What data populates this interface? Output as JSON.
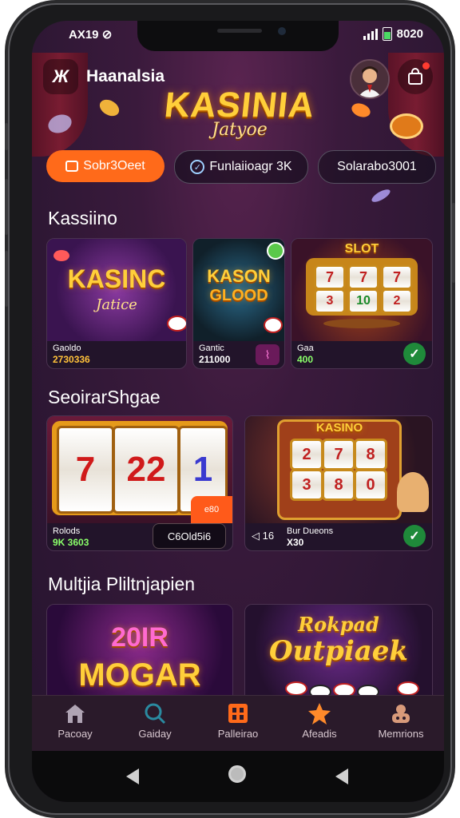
{
  "status_bar": {
    "time": "AX19 ⊘",
    "right_text": "8020"
  },
  "header": {
    "app_title": "Haanalsia",
    "menu_glyph": "Ж"
  },
  "logo": {
    "title": "KASINIA",
    "subtitle": "Jatyoe"
  },
  "filters": [
    {
      "label": "Sobr3Oeet",
      "icon": "bag-icon",
      "active": true
    },
    {
      "label": "Funlaiioagr 3K",
      "icon": "check-circle-icon",
      "active": false
    },
    {
      "label": "Solarabo3001",
      "icon": "",
      "active": false
    }
  ],
  "sections": {
    "s1": {
      "title": "Kassiino"
    },
    "s2": {
      "title": "SeoirarShgae"
    },
    "s3": {
      "title": "Multjia Pliltnjapien"
    }
  },
  "cards_row1": [
    {
      "art_title": "KASINC",
      "art_sub": "Jatice",
      "line1": "Gaoldo",
      "line2": "2730336"
    },
    {
      "art_title": "KASON",
      "art_sub": "GLOOD",
      "line1": "Gantic",
      "line2": "211000"
    },
    {
      "art_title": "SLOT",
      "reels": [
        "7",
        "7",
        "7",
        "3",
        "10",
        "2"
      ],
      "line1": "Gaa",
      "line2": "400"
    }
  ],
  "cards_row2": [
    {
      "reels": [
        "7",
        "22",
        "1"
      ],
      "corner": "e80",
      "line1": "Rolods",
      "line2": "9K 3603",
      "button": "C6Old5i6"
    },
    {
      "art_title": "KASINO",
      "reels": [
        "2",
        "7",
        "8",
        "3",
        "8",
        "0"
      ],
      "line1": "Bur Dueons",
      "line2": "X30",
      "prefix": "◁ 16"
    }
  ],
  "cards_row3": [
    {
      "art_title": "20IR",
      "art_sub": "MOGAR"
    },
    {
      "art_title": "Rokpad",
      "art_sub": "Outpiaek"
    }
  ],
  "tabbar": [
    {
      "label": "Pacoay",
      "icon": "home-icon"
    },
    {
      "label": "Gaiday",
      "icon": "search-icon"
    },
    {
      "label": "Palleirao",
      "icon": "slot-icon"
    },
    {
      "label": "Afeadis",
      "icon": "star-icon"
    },
    {
      "label": "Memrions",
      "icon": "profile-icon"
    }
  ],
  "colors": {
    "accent": "#ff6a1a",
    "gold": "#ffcf3a",
    "bg": "#2e1734",
    "success": "#1f8a3a"
  }
}
